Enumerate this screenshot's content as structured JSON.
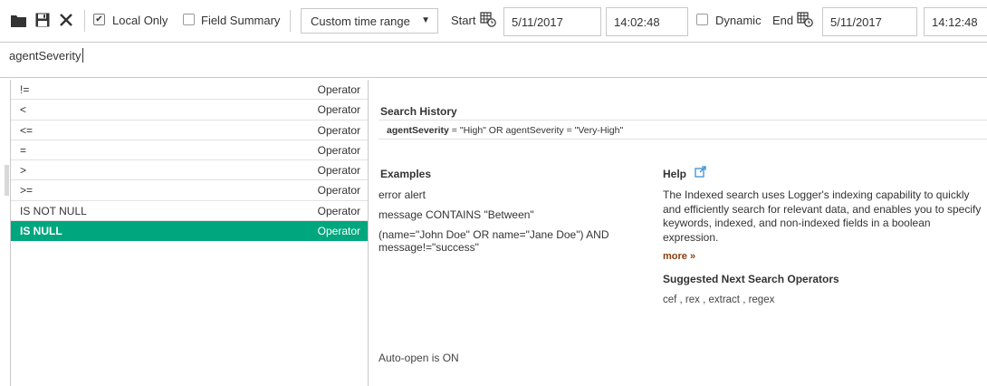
{
  "toolbar": {
    "icons": [
      "folder-icon",
      "save-icon",
      "close-icon"
    ],
    "local_only": {
      "label": "Local Only",
      "checked": true
    },
    "field_summary": {
      "label": "Field Summary",
      "checked": false
    },
    "time_range": {
      "selected": "Custom time range"
    },
    "start": {
      "label": "Start",
      "date": "5/11/2017",
      "time": "14:02:48"
    },
    "dynamic": {
      "label": "Dynamic",
      "checked": false
    },
    "end": {
      "label": "End",
      "date": "5/11/2017",
      "time": "14:12:48"
    }
  },
  "query": {
    "value": "agentSeverity"
  },
  "operators": [
    {
      "name": "!=",
      "type": "Operator"
    },
    {
      "name": "<",
      "type": "Operator"
    },
    {
      "name": "<=",
      "type": "Operator"
    },
    {
      "name": "=",
      "type": "Operator"
    },
    {
      "name": ">",
      "type": "Operator"
    },
    {
      "name": ">=",
      "type": "Operator"
    },
    {
      "name": "IS NOT NULL",
      "type": "Operator"
    },
    {
      "name": "IS NULL",
      "type": "Operator",
      "selected": true
    }
  ],
  "help_panel": {
    "search_history": {
      "title": "Search History",
      "entry_bold": "agentSeverity",
      "entry_rest": " = \"High\" OR agentSeverity = \"Very-High\""
    },
    "examples": {
      "title": "Examples",
      "items": [
        "error alert",
        "message CONTAINS \"Between\"",
        "(name=\"John Doe\" OR name=\"Jane Doe\") AND",
        "message!=\"success\""
      ]
    },
    "help": {
      "title": "Help",
      "text": "The Indexed search uses Logger's indexing capability to quickly and efficiently search for relevant data, and enables you to specify keywords, indexed, and non-indexed fields in a boolean expression.",
      "more": "more »"
    },
    "suggested": {
      "title": "Suggested Next Search Operators",
      "items": "cef , rex , extract , regex"
    },
    "auto_open": "Auto-open is ON"
  },
  "colors": {
    "selected_row": "#00a77e",
    "more_link": "#8a3d10",
    "external_link_icon": "#3a8fd9"
  }
}
